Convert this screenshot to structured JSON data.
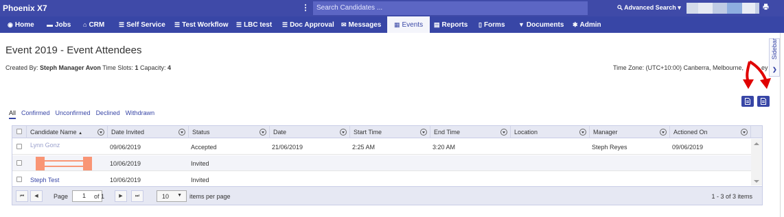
{
  "app": {
    "title": "Phoenix X7"
  },
  "search": {
    "placeholder": "Search Candidates ..."
  },
  "topbar": {
    "advanced_search": "Advanced Search",
    "advanced_search_icon": "search-icon",
    "print_icon": "print-icon",
    "kebab": "⋮"
  },
  "nav": [
    {
      "label": "Home",
      "icon": "globe-icon"
    },
    {
      "label": "Jobs",
      "icon": "folder-icon"
    },
    {
      "label": "CRM",
      "icon": "building-icon"
    },
    {
      "label": "Self Service",
      "icon": "list-icon"
    },
    {
      "label": "Test Workflow",
      "icon": "list-icon"
    },
    {
      "label": "LBC test",
      "icon": "list-icon"
    },
    {
      "label": "Doc Approval",
      "icon": "list-icon"
    },
    {
      "label": "Messages",
      "icon": "envelope-icon"
    },
    {
      "label": "Events",
      "icon": "calendar-icon",
      "active": true
    },
    {
      "label": "Reports",
      "icon": "chart-icon"
    },
    {
      "label": "Forms",
      "icon": "file-icon"
    },
    {
      "label": "Documents",
      "icon": "filter-icon"
    },
    {
      "label": "Admin",
      "icon": "gear-icon"
    }
  ],
  "page": {
    "title": "Event 2019 - Event Attendees",
    "created_by_label": "Created By:",
    "created_by": "Steph Manager Avon",
    "time_slots_label": "Time Slots:",
    "time_slots": "1",
    "capacity_label": "Capacity:",
    "capacity": "4",
    "timezone": "Time Zone: (UTC+10:00) Canberra, Melbourne,",
    "timezone_tail": "ey"
  },
  "sidebar": {
    "label": "Sidebar"
  },
  "tabs": [
    "All",
    "Confirmed",
    "Unconfirmed",
    "Declined",
    "Withdrawn"
  ],
  "grid": {
    "columns": [
      "Candidate Name",
      "Date Invited",
      "Status",
      "Date",
      "Start Time",
      "End Time",
      "Location",
      "Manager",
      "Actioned On"
    ],
    "sort_indicator": "▲",
    "rows": [
      {
        "name": "Lynn Gonz",
        "date_invited": "09/06/2019",
        "status": "Accepted",
        "date": "21/06/2019",
        "start": "2:25 AM",
        "end": "3:20 AM",
        "location": "",
        "manager": "Steph Reyes",
        "actioned_on": "09/06/2019"
      },
      {
        "name": "",
        "date_invited": "10/06/2019",
        "status": "Invited",
        "date": "",
        "start": "",
        "end": "",
        "location": "",
        "manager": "",
        "actioned_on": ""
      },
      {
        "name": "Steph Test",
        "date_invited": "10/06/2019",
        "status": "Invited",
        "date": "",
        "start": "",
        "end": "",
        "location": "",
        "manager": "",
        "actioned_on": ""
      }
    ]
  },
  "pager": {
    "first": "⏮",
    "prev": "◀",
    "next": "▶",
    "last": "⏭",
    "page_label": "Page",
    "page_value": "1",
    "of_label": "of 1",
    "per_page": "10",
    "per_page_label": "items per page",
    "info": "1 - 3 of 3 items"
  },
  "colors": {
    "topbar": "#3f4aa8",
    "nav": "#3846a6",
    "annotation_arrow": "#e00000",
    "redaction": "#f99575"
  }
}
